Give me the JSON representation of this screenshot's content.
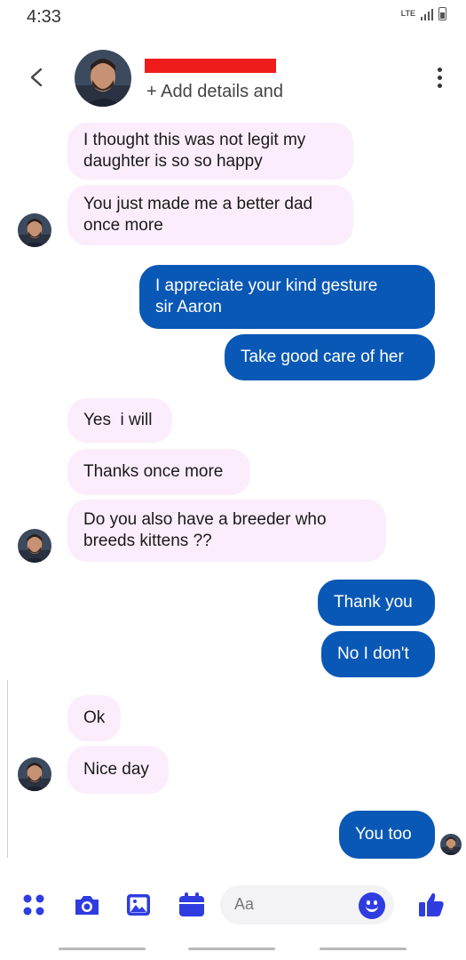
{
  "status_bar": {
    "time": "4:33",
    "network": "LTE"
  },
  "header": {
    "subtitle": "+ Add details and",
    "name_redacted": true
  },
  "messages": [
    {
      "side": "in",
      "text_l1": "I thought this was not legit my",
      "text_l2": "daughter is so so happy"
    },
    {
      "side": "in",
      "text_l1": "You just made me a better dad",
      "text_l2": "once more"
    },
    {
      "side": "out",
      "text_l1": "I appreciate your kind gesture",
      "text_l2": "sir Aaron"
    },
    {
      "side": "out",
      "text": "Take good care of her"
    },
    {
      "side": "in",
      "text": "Yes  i will"
    },
    {
      "side": "in",
      "text": "Thanks once more"
    },
    {
      "side": "in",
      "text_l1": "Do you also have a breeder who",
      "text_l2": "breeds kittens ??"
    },
    {
      "side": "out",
      "text": "Thank you"
    },
    {
      "side": "out",
      "text": "No I don't"
    },
    {
      "side": "in",
      "text": "Ok"
    },
    {
      "side": "in",
      "text": "Nice day"
    },
    {
      "side": "out",
      "text": "You too"
    }
  ],
  "composer": {
    "placeholder": "Aa"
  },
  "colors": {
    "outgoing": "#0a58b5",
    "incoming": "#fbedfb",
    "accent": "#2f3ce0",
    "redaction": "#ef1c1c"
  },
  "icons": [
    "back-arrow-icon",
    "more-options-icon",
    "apps-icon",
    "camera-icon",
    "gallery-icon",
    "calendar-icon",
    "emoji-icon",
    "like-icon"
  ]
}
